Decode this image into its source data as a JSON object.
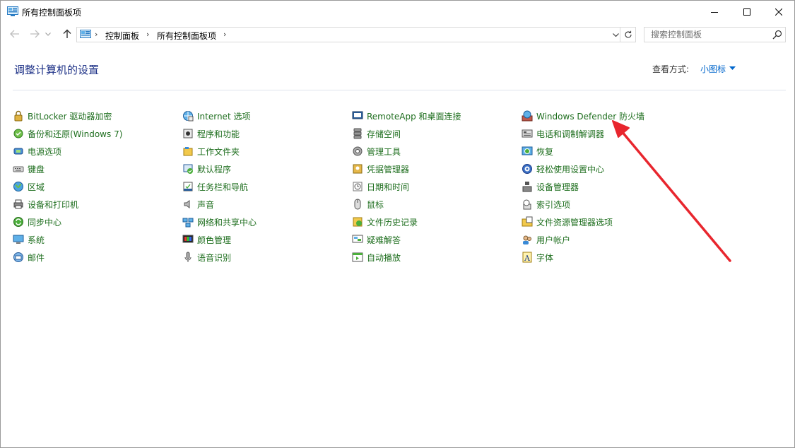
{
  "window": {
    "title": "所有控制面板项"
  },
  "nav": {
    "back_icon": "back-arrow-icon",
    "forward_icon": "forward-arrow-icon",
    "up_icon": "up-arrow-icon",
    "breadcrumbs": [
      "控制面板",
      "所有控制面板项"
    ],
    "search_placeholder": "搜索控制面板"
  },
  "header": {
    "title": "调整计算机的设置",
    "view_by_label": "查看方式:",
    "view_by_value": "小图标"
  },
  "columns": [
    [
      {
        "label": "BitLocker 驱动器加密",
        "icon": "bitlocker-icon"
      },
      {
        "label": "备份和还原(Windows 7)",
        "icon": "backup-icon"
      },
      {
        "label": "电源选项",
        "icon": "power-icon"
      },
      {
        "label": "键盘",
        "icon": "keyboard-icon"
      },
      {
        "label": "区域",
        "icon": "region-icon"
      },
      {
        "label": "设备和打印机",
        "icon": "printer-icon"
      },
      {
        "label": "同步中心",
        "icon": "sync-icon"
      },
      {
        "label": "系统",
        "icon": "system-icon"
      },
      {
        "label": "邮件",
        "icon": "mail-icon"
      }
    ],
    [
      {
        "label": "Internet 选项",
        "icon": "internet-icon"
      },
      {
        "label": "程序和功能",
        "icon": "programs-icon"
      },
      {
        "label": "工作文件夹",
        "icon": "work-folder-icon"
      },
      {
        "label": "默认程序",
        "icon": "default-programs-icon"
      },
      {
        "label": "任务栏和导航",
        "icon": "taskbar-icon"
      },
      {
        "label": "声音",
        "icon": "sound-icon"
      },
      {
        "label": "网络和共享中心",
        "icon": "network-icon"
      },
      {
        "label": "颜色管理",
        "icon": "color-management-icon"
      },
      {
        "label": "语音识别",
        "icon": "microphone-icon"
      }
    ],
    [
      {
        "label": "RemoteApp 和桌面连接",
        "icon": "remoteapp-icon"
      },
      {
        "label": "存储空间",
        "icon": "storage-icon"
      },
      {
        "label": "管理工具",
        "icon": "admin-tools-icon"
      },
      {
        "label": "凭据管理器",
        "icon": "credential-icon"
      },
      {
        "label": "日期和时间",
        "icon": "clock-icon"
      },
      {
        "label": "鼠标",
        "icon": "mouse-icon"
      },
      {
        "label": "文件历史记录",
        "icon": "file-history-icon"
      },
      {
        "label": "疑难解答",
        "icon": "troubleshoot-icon"
      },
      {
        "label": "自动播放",
        "icon": "autoplay-icon"
      }
    ],
    [
      {
        "label": "Windows Defender 防火墙",
        "icon": "firewall-icon"
      },
      {
        "label": "电话和调制解调器",
        "icon": "phone-modem-icon"
      },
      {
        "label": "恢复",
        "icon": "recovery-icon"
      },
      {
        "label": "轻松使用设置中心",
        "icon": "ease-of-access-icon"
      },
      {
        "label": "设备管理器",
        "icon": "device-manager-icon"
      },
      {
        "label": "索引选项",
        "icon": "indexing-icon"
      },
      {
        "label": "文件资源管理器选项",
        "icon": "folder-options-icon"
      },
      {
        "label": "用户帐户",
        "icon": "user-accounts-icon"
      },
      {
        "label": "字体",
        "icon": "fonts-icon"
      }
    ]
  ],
  "colors": {
    "link_green": "#1e6e1e",
    "heading_blue": "#1e3287",
    "accent_blue": "#0066cc",
    "annotation_red": "#e8262e"
  }
}
